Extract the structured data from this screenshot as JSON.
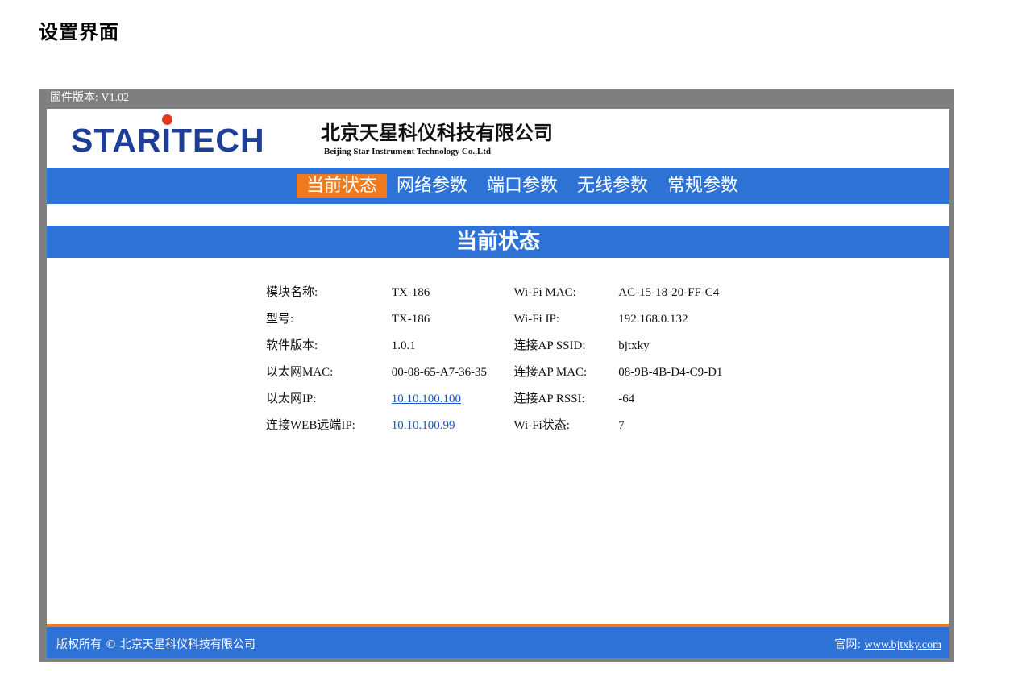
{
  "page": {
    "heading": "设置界面"
  },
  "firmware": {
    "label": "固件版本:",
    "version": "V1.02"
  },
  "logo": {
    "text_before": "STAR",
    "i": "I",
    "text_after": "TECH"
  },
  "company": {
    "name_cn": "北京天星科仪科技有限公司",
    "name_en": "Beijing Star Instrument Technology Co.,Ltd"
  },
  "nav": {
    "items": [
      {
        "label": "当前状态",
        "active": true
      },
      {
        "label": "网络参数",
        "active": false
      },
      {
        "label": "端口参数",
        "active": false
      },
      {
        "label": "无线参数",
        "active": false
      },
      {
        "label": "常规参数",
        "active": false
      }
    ]
  },
  "section": {
    "title": "当前状态"
  },
  "status": {
    "rows": [
      {
        "label1": "模块名称:",
        "value1": "TX-186",
        "label2": "Wi-Fi MAC:",
        "value2": "AC-15-18-20-FF-C4"
      },
      {
        "label1": "型号:",
        "value1": "TX-186",
        "label2": "Wi-Fi IP:",
        "value2": "192.168.0.132"
      },
      {
        "label1": "软件版本:",
        "value1": "1.0.1",
        "label2": "连接AP SSID:",
        "value2": "bjtxky"
      },
      {
        "label1": "以太网MAC:",
        "value1": "00-08-65-A7-36-35",
        "label2": "连接AP MAC:",
        "value2": "08-9B-4B-D4-C9-D1"
      },
      {
        "label1": "以太网IP:",
        "value1": "10.10.100.100",
        "label2": "连接AP RSSI:",
        "value2": "-64"
      },
      {
        "label1": "连接WEB远端IP:",
        "value1": "10.10.100.99",
        "label2": "Wi-Fi状态:",
        "value2": "7"
      }
    ]
  },
  "footer": {
    "copyright": "版权所有 © 北京天星科仪科技有限公司",
    "site_label": "官网:",
    "site_link": "www.bjtxky.com"
  },
  "colors": {
    "nav_blue": "#2f72d5",
    "active_orange": "#f07b1e",
    "frame_gray": "#7f7f7f",
    "logo_blue": "#1f3f96",
    "logo_red": "#e03a1e"
  }
}
